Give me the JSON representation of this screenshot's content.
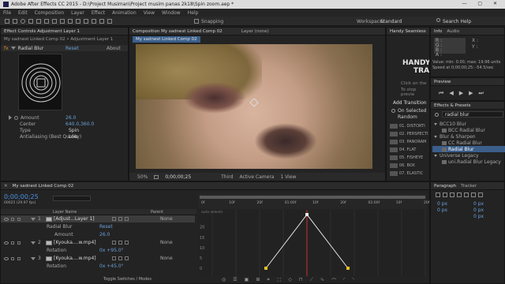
{
  "window": {
    "title": "Adobe After Effects CC 2015 - D:\\Project Musiman\\Project musim panas 2k18\\Spin zoom.aep *"
  },
  "menu": [
    "File",
    "Edit",
    "Composition",
    "Layer",
    "Effect",
    "Animation",
    "View",
    "Window",
    "Help"
  ],
  "toolbar": {
    "snapping": "Snapping",
    "workspace_label": "Workspace:",
    "workspace": "Standard",
    "search_help": "Search Help"
  },
  "effect_controls": {
    "tab": "Effect Controls Adjustment Layer 1",
    "breadcrumb": "My sadnest Linked Comp 02 • Adjustment Layer 1",
    "fx_name": "Radial Blur",
    "reset": "Reset",
    "about": "About",
    "props": [
      {
        "label": "Amount",
        "value": "26.0"
      },
      {
        "label": "Center",
        "value": "640.0,360.0"
      },
      {
        "label": "Type",
        "value": "Spin"
      },
      {
        "label": "Antialiasing (Best Quality)",
        "value": "Low"
      }
    ]
  },
  "composition": {
    "tab": "Composition My sadnest Linked Comp 02",
    "layer_tab": "Layer (none)",
    "comp_name": "My sadnest Linked Comp 02",
    "zoom": "50%",
    "time": "0;00;00;25",
    "quality": "Third",
    "camera": "Active Camera",
    "views": "1 View"
  },
  "handy": {
    "tab": "Handy Seamless",
    "logo1": "HANDY",
    "logo2": "TRA",
    "click1": "Click on the",
    "click2": "To stop previe",
    "add_transition": "Add Transition",
    "on_selected": "On Selected",
    "random": "Random",
    "items": [
      "01. DISTORTI",
      "02. PERSPECTI",
      "03. PANORAM",
      "04. FLAT",
      "05. FISHEYE",
      "06. BOX",
      "07. ELASTIC"
    ]
  },
  "info": {
    "tab": "Info",
    "audio_tab": "Audio",
    "x": "X :",
    "y": "Y :",
    "r": "R :",
    "g": "G :",
    "b": "B :",
    "a": "A :",
    "value_line": "Value: min: 0.00, max: 19.96 units",
    "speed_line": "Speed at 0;00;00;25: -54.5/sec"
  },
  "preview": {
    "tab": "Preview"
  },
  "effects_presets": {
    "tab": "Effects & Presets",
    "search": "radial blur",
    "tree": [
      {
        "label": "BCC10 Blur",
        "indent": 0,
        "group": true
      },
      {
        "label": "BCC Radial Blur",
        "indent": 1,
        "group": false
      },
      {
        "label": "Blur & Sharpen",
        "indent": 0,
        "group": true
      },
      {
        "label": "CC Radial Blur",
        "indent": 1,
        "group": false
      },
      {
        "label": "Radial Blur",
        "indent": 1,
        "group": false,
        "selected": true
      },
      {
        "label": "Universe Legacy",
        "indent": 0,
        "group": true
      },
      {
        "label": "uni.Radial Blur Legacy",
        "indent": 1,
        "group": false
      }
    ]
  },
  "paragraph": {
    "tab": "Paragraph",
    "tracker_tab": "Tracker",
    "v1": "0 px",
    "v2": "0 px",
    "v3": "0 px",
    "v4": "0 px",
    "v5": "0 px"
  },
  "timeline": {
    "tab": "My sadnest Linked Comp 02",
    "timecode": "0;00;00;25",
    "fps": "00025 (29.97 fps)",
    "col_layer": "Layer Name",
    "col_parent": "Parent",
    "toggle": "Toggle Switches / Modes",
    "ruler": [
      "0f",
      "10f",
      "20f",
      "01:00f",
      "10f",
      "20f",
      "02:00f",
      "10f",
      "20f"
    ],
    "graph_label": "auto selects",
    "yticks": [
      "20",
      "15",
      "10",
      "5",
      "0"
    ],
    "layers": [
      {
        "num": "1",
        "name": "[Adjust...Layer 1]",
        "parent": "None",
        "selected": true
      },
      {
        "sub": "Radial Blur",
        "value": "Reset"
      },
      {
        "sub": "Amount",
        "value": "26.0",
        "indent": 2
      },
      {
        "num": "2",
        "name": "[Kyouka....w.mp4]",
        "parent": "None"
      },
      {
        "sub": "Rotation",
        "value": "0x +95.0°"
      },
      {
        "num": "3",
        "name": "[Kyouka....w.mp4]",
        "parent": "None"
      },
      {
        "sub": "Rotation",
        "value": "0x +45.0°"
      }
    ]
  },
  "chart_data": {
    "type": "line",
    "title": "",
    "x": [
      "0;00;00;00",
      "0;00;00;25",
      "0;00;01;15"
    ],
    "series": [
      {
        "name": "Amount",
        "values": [
          0,
          26,
          0
        ]
      }
    ],
    "ylim": [
      0,
      26
    ]
  }
}
